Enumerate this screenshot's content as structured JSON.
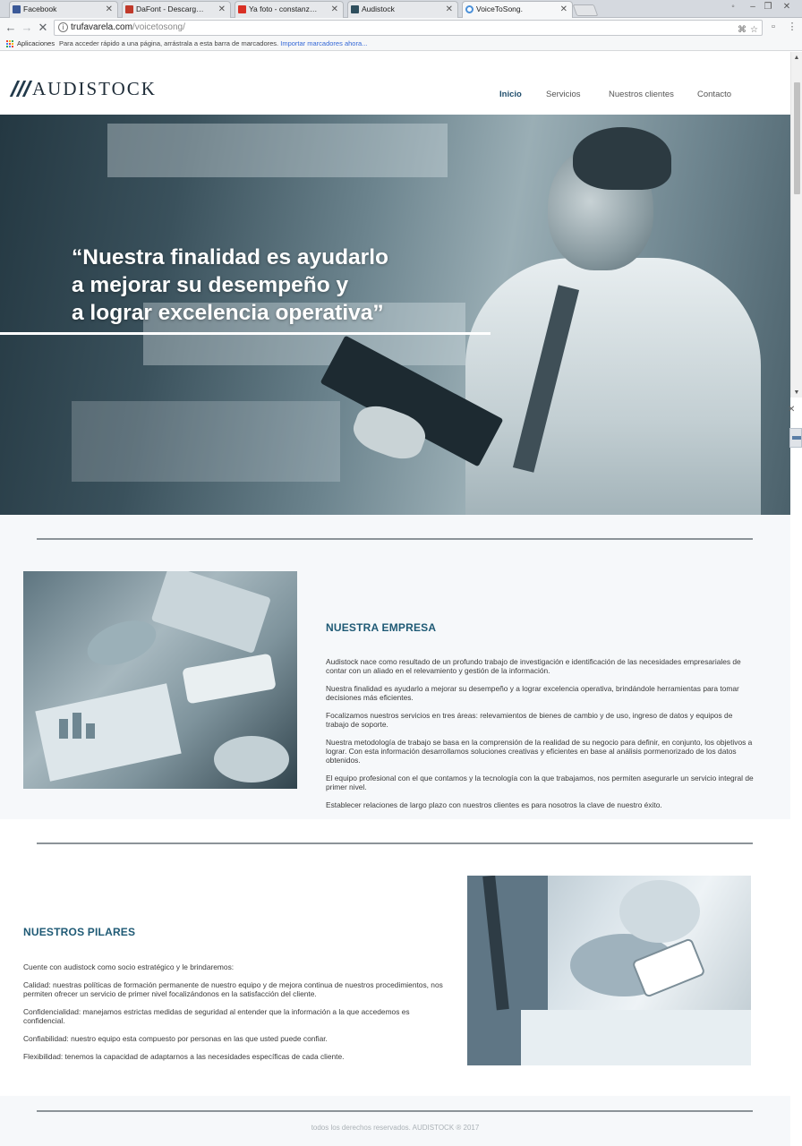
{
  "browser": {
    "tabs": [
      {
        "title": "Facebook",
        "favicon_color": "#3b5998",
        "active": false
      },
      {
        "title": "DaFont - Descargar fuentes",
        "favicon_color": "#c0392b",
        "active": false
      },
      {
        "title": "Ya foto - constanzacolaroff",
        "favicon_color": "#d93025",
        "active": false
      },
      {
        "title": "Audistock",
        "favicon_color": "#2f4f5e",
        "active": false
      },
      {
        "title": "VoiceToSong.",
        "favicon_color": "#4a90d9",
        "active": true
      }
    ],
    "address": {
      "host": "trufavarela.com",
      "path": "/voicetosong/"
    },
    "bookmarks": {
      "apps_label": "Aplicaciones",
      "hint": "Para acceder rápido a una página, arrástrala a esta barra de marcadores.",
      "import_link": "Importar marcadores ahora..."
    }
  },
  "site": {
    "logo": "AUDISTOCK",
    "nav": [
      {
        "label": "Inicio",
        "active": true
      },
      {
        "label": "Servicios",
        "active": false
      },
      {
        "label": "Nuestros clientes",
        "active": false
      },
      {
        "label": "Contacto",
        "active": false
      }
    ],
    "hero": {
      "quote_lines": [
        "“Nuestra finalidad es ayudarlo",
        "a mejorar su desempeño y",
        "a lograr excelencia operativa”"
      ]
    },
    "empresa": {
      "title": "NUESTRA EMPRESA",
      "paragraphs": [
        "Audistock nace como resultado de un profundo trabajo de investigación e identificación de las necesidades empresariales de contar con un aliado en el relevamiento y gestión de la información.",
        "Nuestra finalidad es ayudarlo a mejorar su desempeño y a lograr excelencia operativa, brindándole herramientas para tomar decisiones más eficientes.",
        "Focalizamos nuestros servicios en tres áreas: relevamientos de bienes de cambio y de uso, ingreso de datos y equipos de trabajo de soporte.",
        "Nuestra metodología de trabajo se basa en la comprensión de la realidad de su negocio para definir, en conjunto, los objetivos a lograr. Con esta información desarrollamos soluciones creativas y eficientes en base al análisis pormenorizado de los datos obtenidos.",
        "El equipo profesional con el que contamos y la tecnología con la que trabajamos, nos permiten asegurarle un servicio integral de primer nivel.",
        "Establecer relaciones de largo plazo con nuestros clientes es para nosotros la clave de nuestro éxito."
      ]
    },
    "pilares": {
      "title": "NUESTROS PILARES",
      "paragraphs": [
        "Cuente con audistock como socio estratégico y le brindaremos:",
        "Calidad: nuestras políticas de formación permanente de nuestro equipo y de mejora continua de nuestros procedimientos, nos permiten ofrecer un servicio de primer nivel focalizándonos en la satisfacción del cliente.",
        "Confidencialidad: manejamos estrictas medidas de seguridad al entender que la información a la que accedemos es confidencial.",
        "Confiabilidad: nuestro equipo esta compuesto por personas en las que usted puede confiar.",
        "Flexibilidad: tenemos la capacidad de adaptarnos a las necesidades específicas de cada cliente."
      ]
    },
    "footer": "todos los derechos reservados. AUDISTOCK ® 2017"
  }
}
